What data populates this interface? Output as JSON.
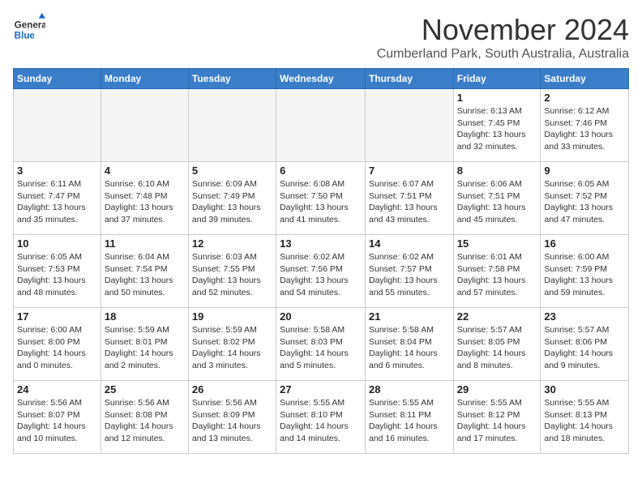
{
  "logo": {
    "general": "General",
    "blue": "Blue"
  },
  "title": "November 2024",
  "subtitle": "Cumberland Park, South Australia, Australia",
  "days_of_week": [
    "Sunday",
    "Monday",
    "Tuesday",
    "Wednesday",
    "Thursday",
    "Friday",
    "Saturday"
  ],
  "weeks": [
    [
      {
        "day": "",
        "info": ""
      },
      {
        "day": "",
        "info": ""
      },
      {
        "day": "",
        "info": ""
      },
      {
        "day": "",
        "info": ""
      },
      {
        "day": "",
        "info": ""
      },
      {
        "day": "1",
        "info": "Sunrise: 6:13 AM\nSunset: 7:45 PM\nDaylight: 13 hours\nand 32 minutes."
      },
      {
        "day": "2",
        "info": "Sunrise: 6:12 AM\nSunset: 7:46 PM\nDaylight: 13 hours\nand 33 minutes."
      }
    ],
    [
      {
        "day": "3",
        "info": "Sunrise: 6:11 AM\nSunset: 7:47 PM\nDaylight: 13 hours\nand 35 minutes."
      },
      {
        "day": "4",
        "info": "Sunrise: 6:10 AM\nSunset: 7:48 PM\nDaylight: 13 hours\nand 37 minutes."
      },
      {
        "day": "5",
        "info": "Sunrise: 6:09 AM\nSunset: 7:49 PM\nDaylight: 13 hours\nand 39 minutes."
      },
      {
        "day": "6",
        "info": "Sunrise: 6:08 AM\nSunset: 7:50 PM\nDaylight: 13 hours\nand 41 minutes."
      },
      {
        "day": "7",
        "info": "Sunrise: 6:07 AM\nSunset: 7:51 PM\nDaylight: 13 hours\nand 43 minutes."
      },
      {
        "day": "8",
        "info": "Sunrise: 6:06 AM\nSunset: 7:51 PM\nDaylight: 13 hours\nand 45 minutes."
      },
      {
        "day": "9",
        "info": "Sunrise: 6:05 AM\nSunset: 7:52 PM\nDaylight: 13 hours\nand 47 minutes."
      }
    ],
    [
      {
        "day": "10",
        "info": "Sunrise: 6:05 AM\nSunset: 7:53 PM\nDaylight: 13 hours\nand 48 minutes."
      },
      {
        "day": "11",
        "info": "Sunrise: 6:04 AM\nSunset: 7:54 PM\nDaylight: 13 hours\nand 50 minutes."
      },
      {
        "day": "12",
        "info": "Sunrise: 6:03 AM\nSunset: 7:55 PM\nDaylight: 13 hours\nand 52 minutes."
      },
      {
        "day": "13",
        "info": "Sunrise: 6:02 AM\nSunset: 7:56 PM\nDaylight: 13 hours\nand 54 minutes."
      },
      {
        "day": "14",
        "info": "Sunrise: 6:02 AM\nSunset: 7:57 PM\nDaylight: 13 hours\nand 55 minutes."
      },
      {
        "day": "15",
        "info": "Sunrise: 6:01 AM\nSunset: 7:58 PM\nDaylight: 13 hours\nand 57 minutes."
      },
      {
        "day": "16",
        "info": "Sunrise: 6:00 AM\nSunset: 7:59 PM\nDaylight: 13 hours\nand 59 minutes."
      }
    ],
    [
      {
        "day": "17",
        "info": "Sunrise: 6:00 AM\nSunset: 8:00 PM\nDaylight: 14 hours\nand 0 minutes."
      },
      {
        "day": "18",
        "info": "Sunrise: 5:59 AM\nSunset: 8:01 PM\nDaylight: 14 hours\nand 2 minutes."
      },
      {
        "day": "19",
        "info": "Sunrise: 5:59 AM\nSunset: 8:02 PM\nDaylight: 14 hours\nand 3 minutes."
      },
      {
        "day": "20",
        "info": "Sunrise: 5:58 AM\nSunset: 8:03 PM\nDaylight: 14 hours\nand 5 minutes."
      },
      {
        "day": "21",
        "info": "Sunrise: 5:58 AM\nSunset: 8:04 PM\nDaylight: 14 hours\nand 6 minutes."
      },
      {
        "day": "22",
        "info": "Sunrise: 5:57 AM\nSunset: 8:05 PM\nDaylight: 14 hours\nand 8 minutes."
      },
      {
        "day": "23",
        "info": "Sunrise: 5:57 AM\nSunset: 8:06 PM\nDaylight: 14 hours\nand 9 minutes."
      }
    ],
    [
      {
        "day": "24",
        "info": "Sunrise: 5:56 AM\nSunset: 8:07 PM\nDaylight: 14 hours\nand 10 minutes."
      },
      {
        "day": "25",
        "info": "Sunrise: 5:56 AM\nSunset: 8:08 PM\nDaylight: 14 hours\nand 12 minutes."
      },
      {
        "day": "26",
        "info": "Sunrise: 5:56 AM\nSunset: 8:09 PM\nDaylight: 14 hours\nand 13 minutes."
      },
      {
        "day": "27",
        "info": "Sunrise: 5:55 AM\nSunset: 8:10 PM\nDaylight: 14 hours\nand 14 minutes."
      },
      {
        "day": "28",
        "info": "Sunrise: 5:55 AM\nSunset: 8:11 PM\nDaylight: 14 hours\nand 16 minutes."
      },
      {
        "day": "29",
        "info": "Sunrise: 5:55 AM\nSunset: 8:12 PM\nDaylight: 14 hours\nand 17 minutes."
      },
      {
        "day": "30",
        "info": "Sunrise: 5:55 AM\nSunset: 8:13 PM\nDaylight: 14 hours\nand 18 minutes."
      }
    ]
  ]
}
